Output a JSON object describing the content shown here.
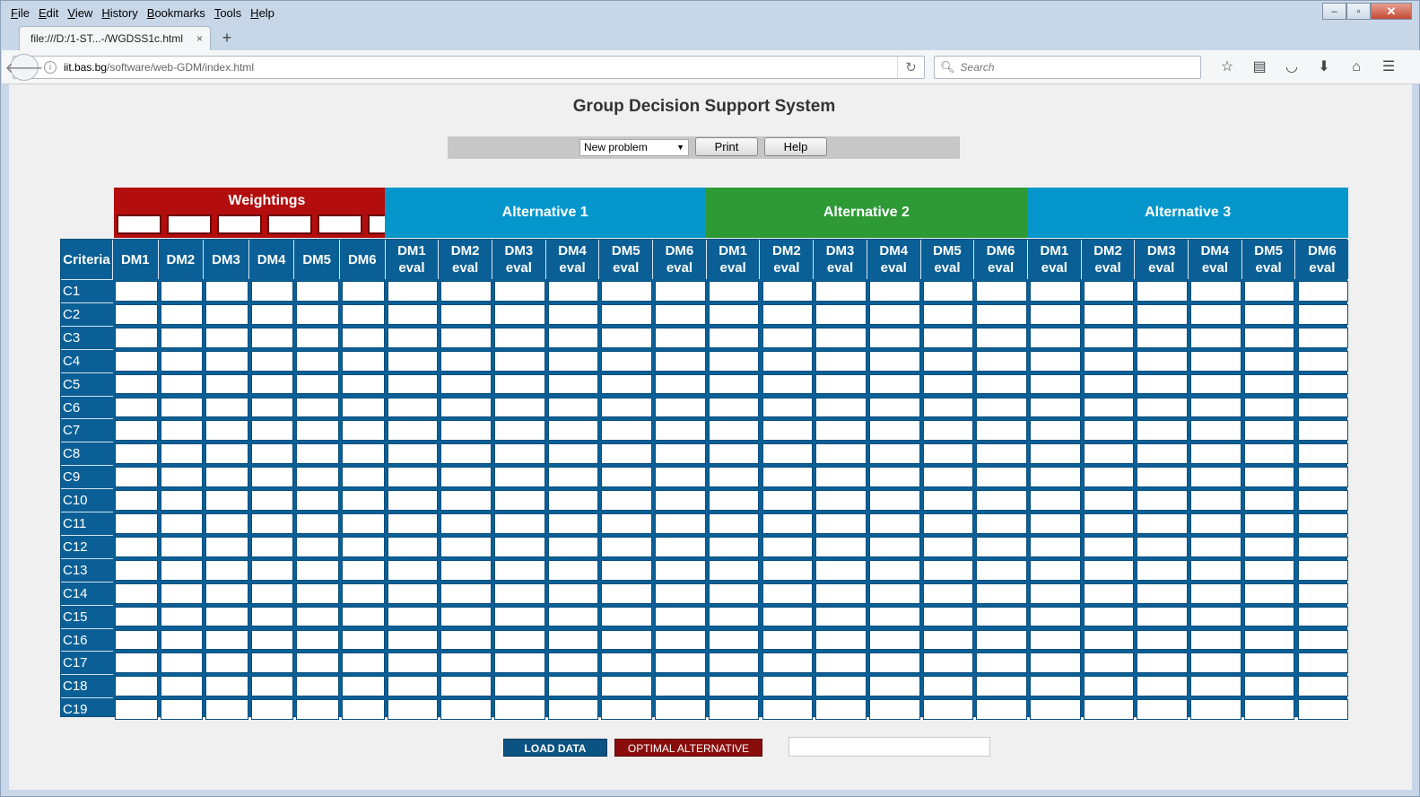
{
  "menu": [
    "File",
    "Edit",
    "View",
    "History",
    "Bookmarks",
    "Tools",
    "Help"
  ],
  "window_controls": {
    "minimize": "‒",
    "maximize": "▫",
    "close": "✕"
  },
  "tab": {
    "title": "file:///D:/1-ST...-/WGDSS1c.html",
    "close": "×",
    "new_tab": "+"
  },
  "url": {
    "host": "iit.bas.bg",
    "path": "/software/web-GDM/index.html"
  },
  "search": {
    "placeholder": "Search"
  },
  "page": {
    "title": "Group Decision Support System",
    "select_value": "New problem",
    "print_label": "Print",
    "help_label": "Help"
  },
  "weightings": {
    "title": "Weightings",
    "count": 6
  },
  "alternatives": [
    {
      "name": "Alternative 1",
      "color": "#0596cc"
    },
    {
      "name": "Alternative 2",
      "color": "#2e9a35"
    },
    {
      "name": "Alternative 3",
      "color": "#0596cc"
    }
  ],
  "columns": {
    "criteria": "Criteria",
    "weights": [
      "DM1",
      "DM2",
      "DM3",
      "DM4",
      "DM5",
      "DM6"
    ],
    "evals": [
      "DM1 eval",
      "DM2 eval",
      "DM3 eval",
      "DM4 eval",
      "DM5 eval",
      "DM6 eval"
    ]
  },
  "rows": [
    "C1",
    "C2",
    "C3",
    "C4",
    "C5",
    "C6",
    "C7",
    "C8",
    "C9",
    "C10",
    "C11",
    "C12",
    "C13",
    "C14",
    "C15",
    "C16",
    "C17",
    "C18",
    "C19"
  ],
  "bottom": {
    "load_label": "LOAD DATA",
    "optimal_label": "OPTIMAL ALTERNATIVE"
  }
}
